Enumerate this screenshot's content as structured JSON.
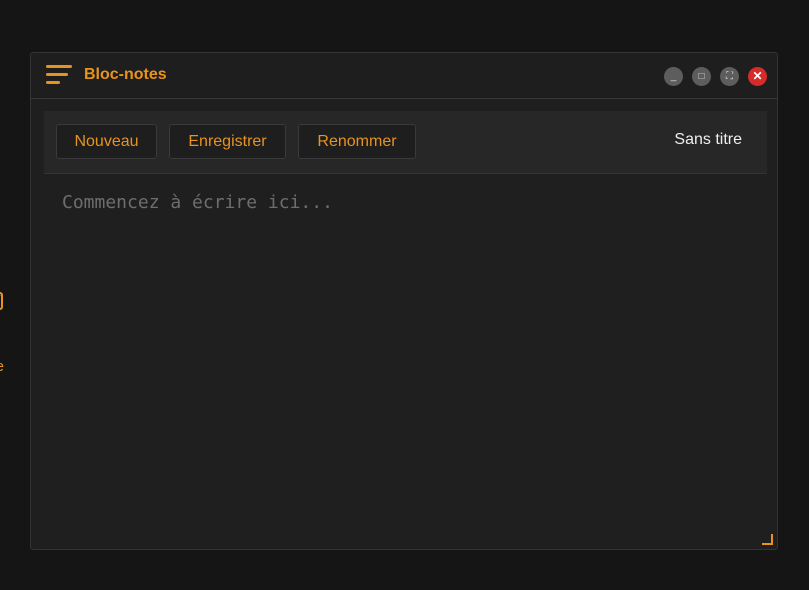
{
  "desktop": {
    "icons": [
      {
        "label": "Courrier",
        "icon": "mail-icon",
        "visible_label": "urrie"
      }
    ]
  },
  "window": {
    "title": "Bloc-notes",
    "menu_icon": "hamburger-menu-icon",
    "controls": {
      "minimize": "_",
      "maximize": "□",
      "fullscreen": "⛶",
      "close": "✕"
    }
  },
  "toolbar": {
    "new_label": "Nouveau",
    "save_label": "Enregistrer",
    "rename_label": "Renommer",
    "document_name": "Sans titre"
  },
  "editor": {
    "value": "",
    "placeholder": "Commencez à écrire ici..."
  },
  "colors": {
    "accent": "#e8931f",
    "background": "#151515",
    "window": "#1f1f1f",
    "toolbar": "#272727",
    "close": "#d42b2b"
  }
}
